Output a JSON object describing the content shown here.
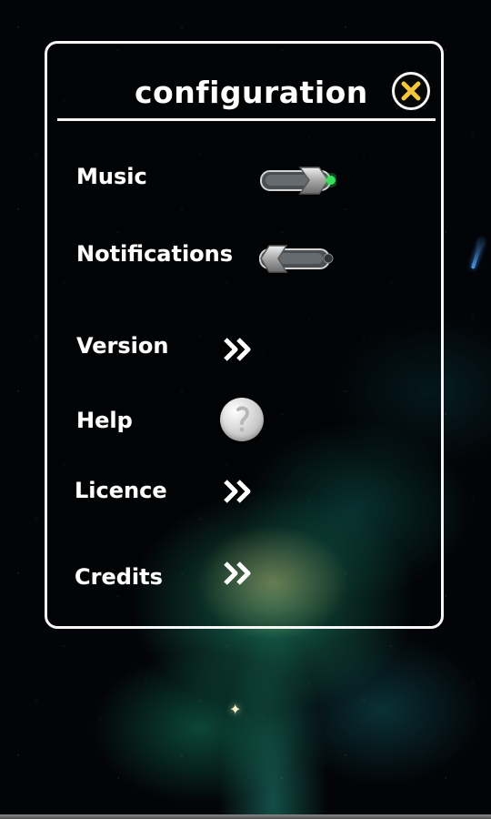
{
  "panel": {
    "title": "configuration",
    "close_icon": "close-x-icon"
  },
  "settings": {
    "music": {
      "label": "Music",
      "state": "on"
    },
    "notifications": {
      "label": "Notifications",
      "state": "off"
    },
    "version": {
      "label": "Version",
      "icon": "double-chevron-right-icon"
    },
    "help": {
      "label": "Help",
      "icon": "help-circle-icon"
    },
    "licence": {
      "label": "Licence",
      "icon": "double-chevron-right-icon"
    },
    "credits": {
      "label": "Credits",
      "icon": "double-chevron-right-icon"
    }
  },
  "colors": {
    "panel_border": "#f7f7f7",
    "accent_close": "#f3c63d",
    "toggle_on": "#38e05c",
    "toggle_off": "#5a5f61"
  }
}
